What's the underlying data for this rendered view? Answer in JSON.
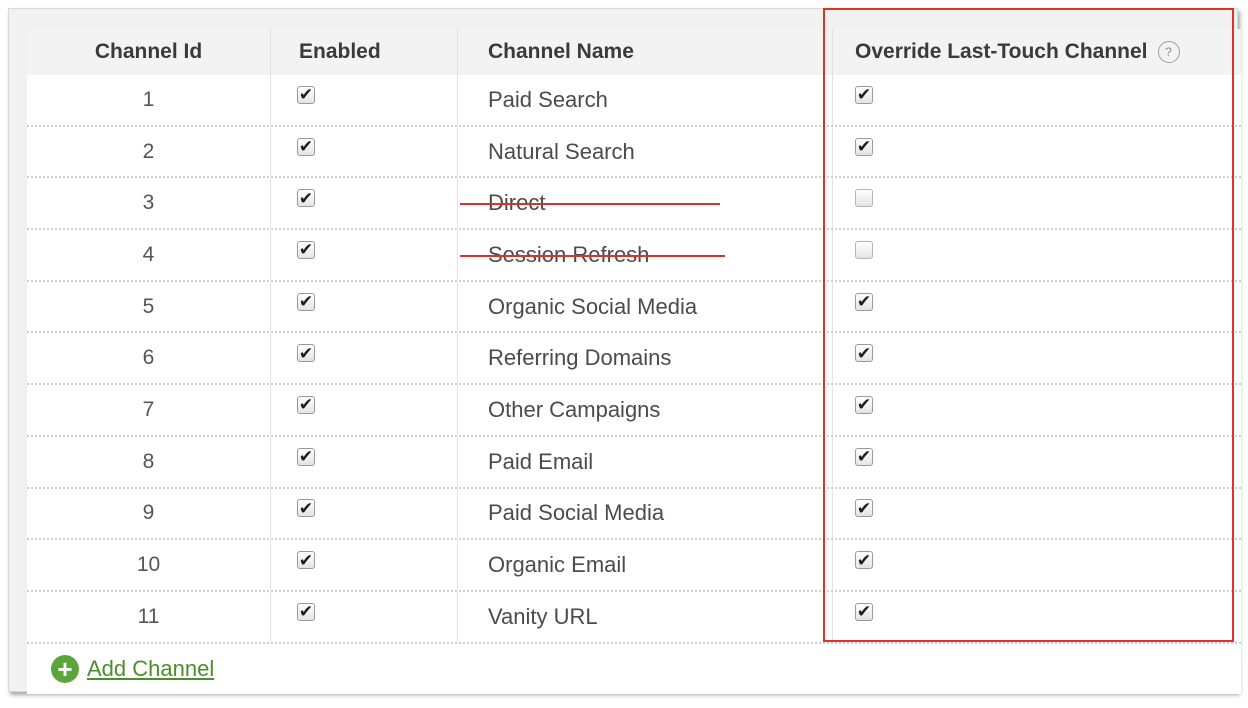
{
  "table": {
    "headers": {
      "channel_id": "Channel Id",
      "enabled": "Enabled",
      "channel_name": "Channel Name",
      "override": "Override Last-Touch Channel"
    },
    "help_icon_glyph": "?",
    "rows": [
      {
        "id": "1",
        "enabled": true,
        "name": "Paid Search",
        "override": true,
        "struck": false
      },
      {
        "id": "2",
        "enabled": true,
        "name": "Natural Search",
        "override": true,
        "struck": false
      },
      {
        "id": "3",
        "enabled": true,
        "name": "Direct",
        "override": false,
        "struck": true
      },
      {
        "id": "4",
        "enabled": true,
        "name": "Session Refresh",
        "override": false,
        "struck": true
      },
      {
        "id": "5",
        "enabled": true,
        "name": "Organic Social Media",
        "override": true,
        "struck": false
      },
      {
        "id": "6",
        "enabled": true,
        "name": "Referring Domains",
        "override": true,
        "struck": false
      },
      {
        "id": "7",
        "enabled": true,
        "name": "Other Campaigns",
        "override": true,
        "struck": false
      },
      {
        "id": "8",
        "enabled": true,
        "name": "Paid Email",
        "override": true,
        "struck": false
      },
      {
        "id": "9",
        "enabled": true,
        "name": "Paid Social Media",
        "override": true,
        "struck": false
      },
      {
        "id": "10",
        "enabled": true,
        "name": "Organic Email",
        "override": true,
        "struck": false
      },
      {
        "id": "11",
        "enabled": true,
        "name": "Vanity URL",
        "override": true,
        "struck": false
      }
    ]
  },
  "add_channel_label": "Add Channel",
  "colors": {
    "highlight": "#e0302a",
    "link": "#4b8f2c",
    "plus_icon": "#5ca53b"
  }
}
